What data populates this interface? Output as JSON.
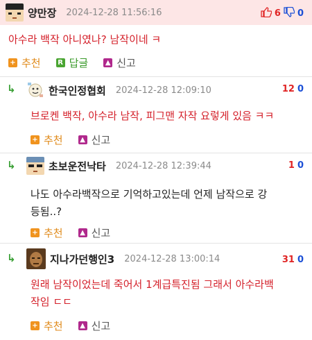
{
  "comments": [
    {
      "nick": "양만장",
      "date": "2024-12-28 11:56:16",
      "up": "6",
      "down": "0",
      "text": "아수라 백작 아니였나? 남작이네 ㅋ",
      "recommend": "추천",
      "reply": "답글",
      "report": "신고"
    },
    {
      "nick": "한국인정협회",
      "date": "2024-12-28 12:09:10",
      "up": "12",
      "down": "0",
      "text": "브로켄 백작, 아수라 남작, 피그맨 자작 요렇게 있음 ㅋㅋ",
      "recommend": "추천",
      "report": "신고"
    },
    {
      "nick": "초보운전낙타",
      "date": "2024-12-28 12:39:44",
      "up": "1",
      "down": "0",
      "text_line1": "나도 아수라백작으로 기억하고있는데 언제 남작으로 강",
      "text_line2": "등됨..?",
      "recommend": "추천",
      "report": "신고"
    },
    {
      "nick": "지나가던행인3",
      "date": "2024-12-28 13:00:14",
      "up": "31",
      "down": "0",
      "text_line1": "원래 남작이었는데 죽어서 1계급특진됨 그래서 아수라백",
      "text_line2": "작임 ㄷㄷ",
      "recommend": "추천",
      "report": "신고"
    }
  ],
  "colors": {
    "highlight_bg": "#fde6e6",
    "reply_arrow": "#3aa035",
    "up": "#e02424",
    "down": "#1b4fd6"
  },
  "icons": {
    "reply_arrow": "reply-arrow-icon",
    "thumb_up": "thumb-up-icon",
    "thumb_down": "thumb-down-icon",
    "recommend": "plus-icon",
    "reply": "reply-r-icon",
    "report": "siren-icon"
  }
}
